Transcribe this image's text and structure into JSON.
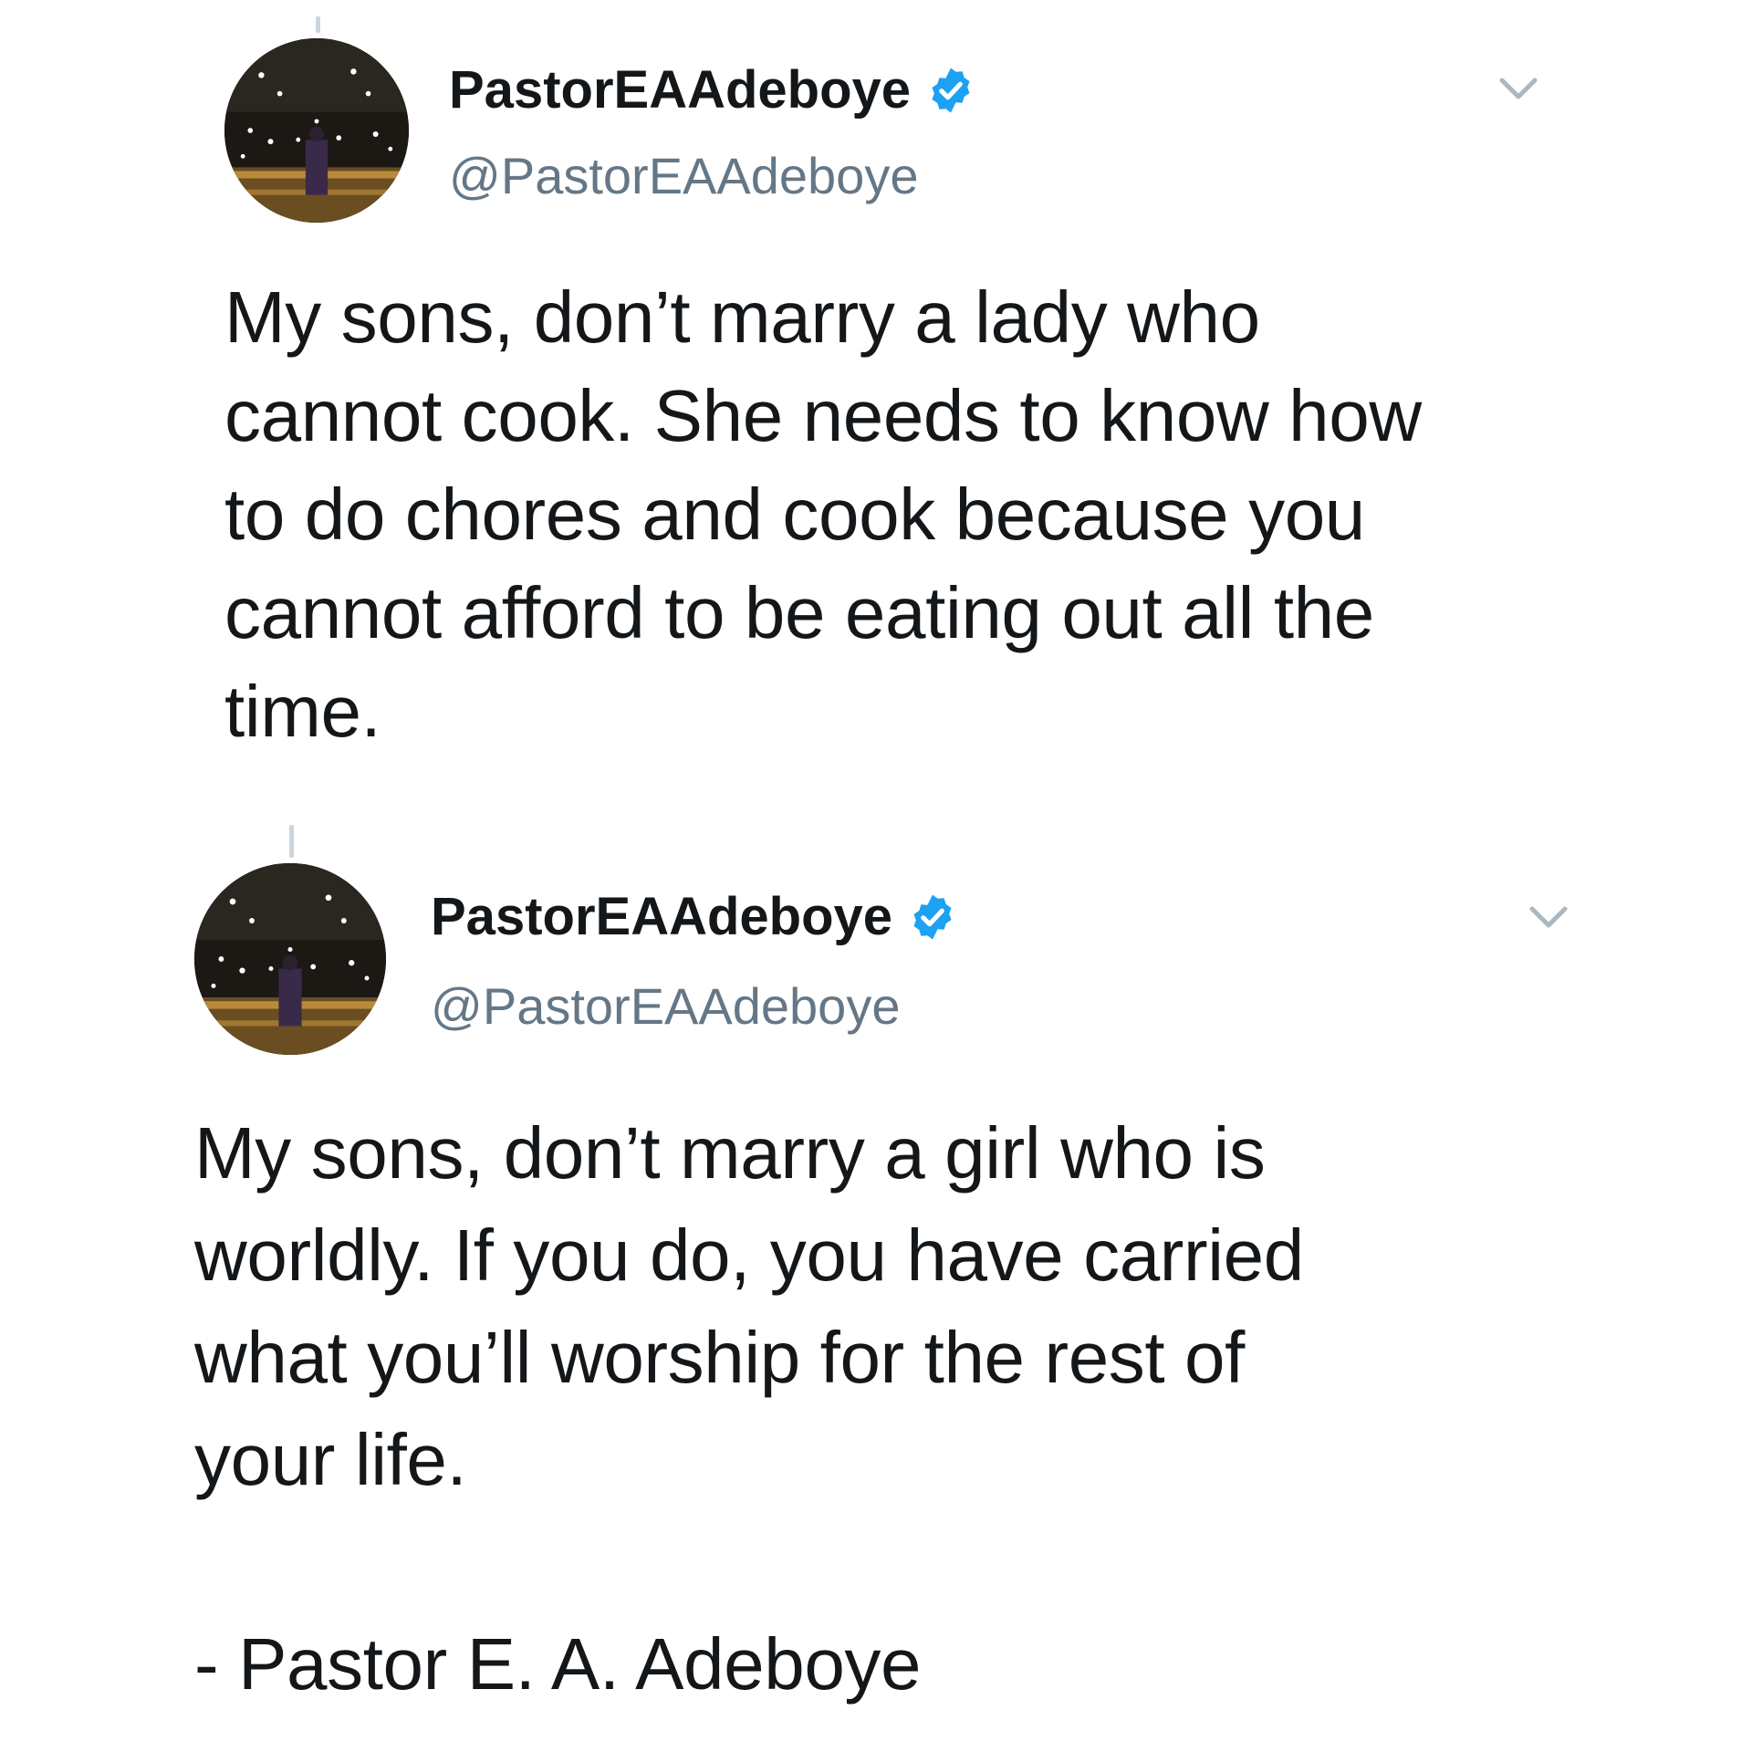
{
  "tweets": [
    {
      "display_name": "PastorEAAdeboye",
      "handle": "@PastorEAAdeboye",
      "verified": true,
      "text": "My sons, don’t marry a lady who\ncannot cook. She needs to know how\nto do chores and cook because you\ncannot afford to be eating out all the\ntime."
    },
    {
      "display_name": "PastorEAAdeboye",
      "handle": "@PastorEAAdeboye",
      "verified": true,
      "text": "My sons, don’t marry a girl who is\nworldly. If you do, you have carried\nwhat you’ll worship for the rest of\nyour life.\n\n- Pastor E. A. Adeboye"
    }
  ],
  "colors": {
    "text": "#14171a",
    "secondary": "#657786",
    "verified_badge": "#1da1f2",
    "thread_line": "#ccd6dd"
  },
  "icons": [
    "verified-badge-icon",
    "chevron-down-icon"
  ]
}
